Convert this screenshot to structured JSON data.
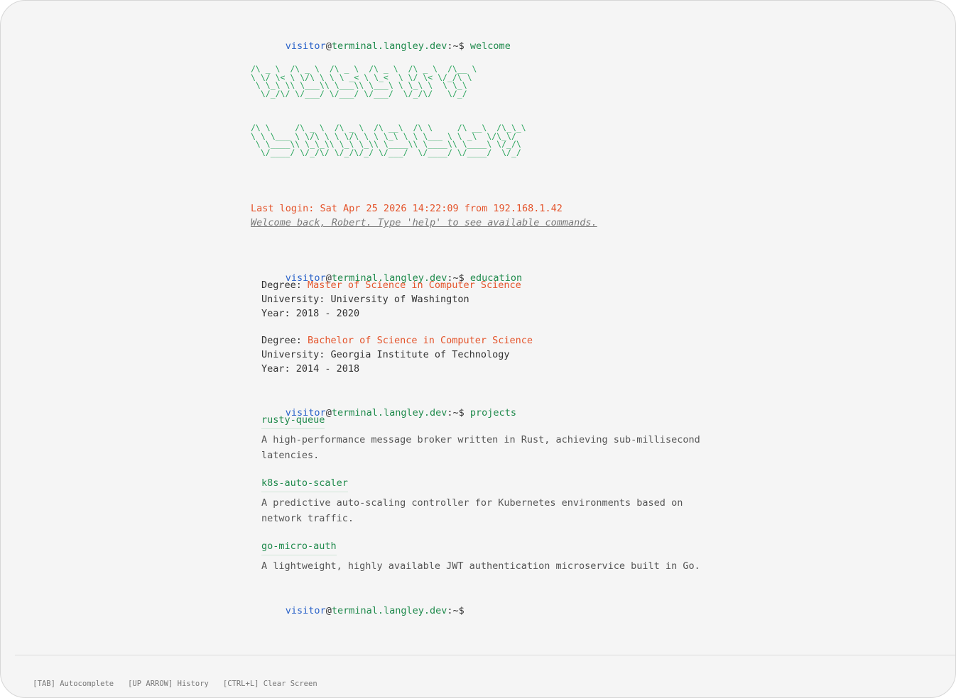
{
  "prompt": {
    "user": "visitor",
    "at": "@",
    "host": "terminal.langley.dev",
    "path": ":~$"
  },
  "commands": {
    "welcome": "welcome",
    "education": "education",
    "projects": "projects"
  },
  "banner": {
    "row1": "/\\ _ \\  /\\ _ \\  /\\ _ \\  /\\ _ \\  /\\ _ \\  /\\__ \\\n\\ \\/ \\< \\ \\/\\ \\ \\ \\ _< \\ \\_<  \\ \\/ \\< \\/_/\\ \\\n \\ \\_\\ \\\\ \\___\\\\ \\___\\\\ \\___\\ \\ \\_\\ \\  \\ \\_\\\n  \\/_/\\/ \\/___/ \\/___/ \\/___/  \\/_/\\/   \\/_/",
    "row2": "/\\ \\     /\\ _ \\  /\\ _ \\  /\\ __\\  /\\ \\     /\\ __\\  /\\_\\_\\\n\\ \\ \\___ \\ \\/\\ \\ \\ \\/\\ \\ \\ \\_\\ \\ \\ \\___ \\ \\ _\\  \\/\\_\\/\n \\ \\____\\\\ \\_\\_\\\\ \\_\\ \\_\\\\ \\____\\\\ \\____\\\\ \\____\\ \\/_/\\\n  \\/____/ \\/_/\\/ \\/_/\\/_/ \\/___/  \\/____/ \\/____/  \\/_/"
  },
  "login": {
    "text": "Last login: Sat Apr 25 2026 14:22:09 from 192.168.1.42",
    "hint": "Welcome back, Robert. Type 'help' to see available commands."
  },
  "education": [
    {
      "degree_label": "Degree: ",
      "degree": "Master of Science in Computer Science",
      "university": "University: University of Washington",
      "year": "Year: 2018 - 2020"
    },
    {
      "degree_label": "Degree: ",
      "degree": "Bachelor of Science in Computer Science",
      "university": "University: Georgia Institute of Technology",
      "year": "Year: 2014 - 2018"
    }
  ],
  "projects": [
    {
      "name": "rusty-queue",
      "desc": "A high-performance message broker written in Rust, achieving sub-millisecond latencies."
    },
    {
      "name": "k8s-auto-scaler",
      "desc": "A predictive auto-scaling controller for Kubernetes environments based on network traffic."
    },
    {
      "name": "go-micro-auth",
      "desc": "A lightweight, highly available JWT authentication microservice built in Go."
    }
  ],
  "footer": {
    "tab": "[TAB] Autocomplete",
    "history": "[UP ARROW] History",
    "clear": "[CTRL+L] Clear Screen"
  }
}
